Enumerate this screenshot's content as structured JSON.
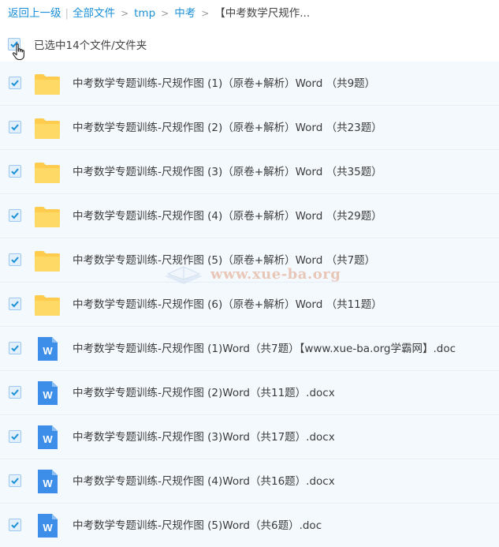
{
  "breadcrumb": {
    "back": "返回上一级",
    "all_files": "全部文件",
    "crumbs": [
      "tmp",
      "中考"
    ],
    "current": "【中考数学尺规作..."
  },
  "selection": {
    "status": "已选中14个文件/文件夹"
  },
  "colors": {
    "accent": "#1a8fd8",
    "row_bg": "#f4f9fe",
    "folder": "#ffcc4d",
    "word": "#3c8ee8"
  },
  "files": [
    {
      "type": "folder",
      "name": "中考数学专题训练-尺规作图 (1)（原卷+解析）Word （共9题）",
      "checked": true
    },
    {
      "type": "folder",
      "name": "中考数学专题训练-尺规作图 (2)（原卷+解析）Word （共23题）",
      "checked": true
    },
    {
      "type": "folder",
      "name": "中考数学专题训练-尺规作图 (3)（原卷+解析）Word （共35题）",
      "checked": true
    },
    {
      "type": "folder",
      "name": "中考数学专题训练-尺规作图 (4)（原卷+解析）Word （共29题）",
      "checked": true
    },
    {
      "type": "folder",
      "name": "中考数学专题训练-尺规作图 (5)（原卷+解析）Word （共7题）",
      "checked": true
    },
    {
      "type": "folder",
      "name": "中考数学专题训练-尺规作图 (6)（原卷+解析）Word （共11题）",
      "checked": true
    },
    {
      "type": "word",
      "name": "中考数学专题训练-尺规作图 (1)Word（共7题）【www.xue-ba.org学霸网】.doc",
      "checked": true
    },
    {
      "type": "word",
      "name": "中考数学专题训练-尺规作图 (2)Word（共11题）.docx",
      "checked": true
    },
    {
      "type": "word",
      "name": "中考数学专题训练-尺规作图 (3)Word（共17题）.docx",
      "checked": true
    },
    {
      "type": "word",
      "name": "中考数学专题训练-尺规作图 (4)Word（共16题）.docx",
      "checked": true
    },
    {
      "type": "word",
      "name": "中考数学专题训练-尺规作图 (5)Word（共6题）.doc",
      "checked": true
    }
  ],
  "watermark": {
    "text": "www.xue-ba.org"
  }
}
